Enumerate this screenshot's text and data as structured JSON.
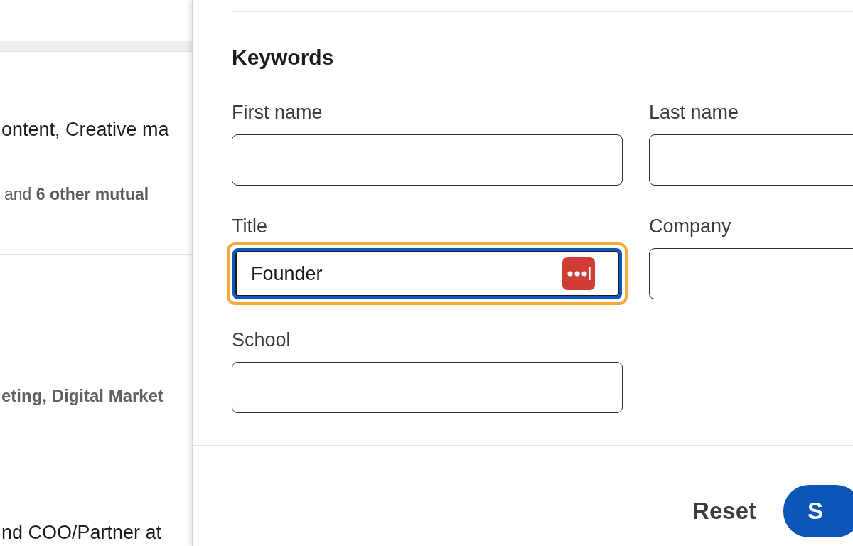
{
  "results": [
    {
      "lines": [
        {
          "kind": "headline",
          "text": "ontent, Creative ma"
        },
        {
          "kind": "mutual",
          "text": "and **6 other mutual**"
        }
      ]
    },
    {
      "lines": [
        {
          "kind": "summary",
          "text": "eting, Digital Market"
        }
      ]
    },
    {
      "lines": [
        {
          "kind": "headline",
          "text": "nd COO/Partner at"
        }
      ]
    }
  ],
  "filter_panel": {
    "heading": "Keywords",
    "fields": [
      {
        "label": "First name",
        "focused": false
      },
      {
        "label": "Last name",
        "focused": false
      },
      {
        "label": "Title",
        "value": "Founder",
        "focused": true,
        "password_manager": true
      },
      {
        "label": "Company",
        "focused": false
      },
      {
        "label": "School",
        "focused": false
      }
    ],
    "buttons": [
      {
        "kind": "text",
        "label": "Reset"
      },
      {
        "kind": "primary",
        "label": "S"
      }
    ]
  }
}
